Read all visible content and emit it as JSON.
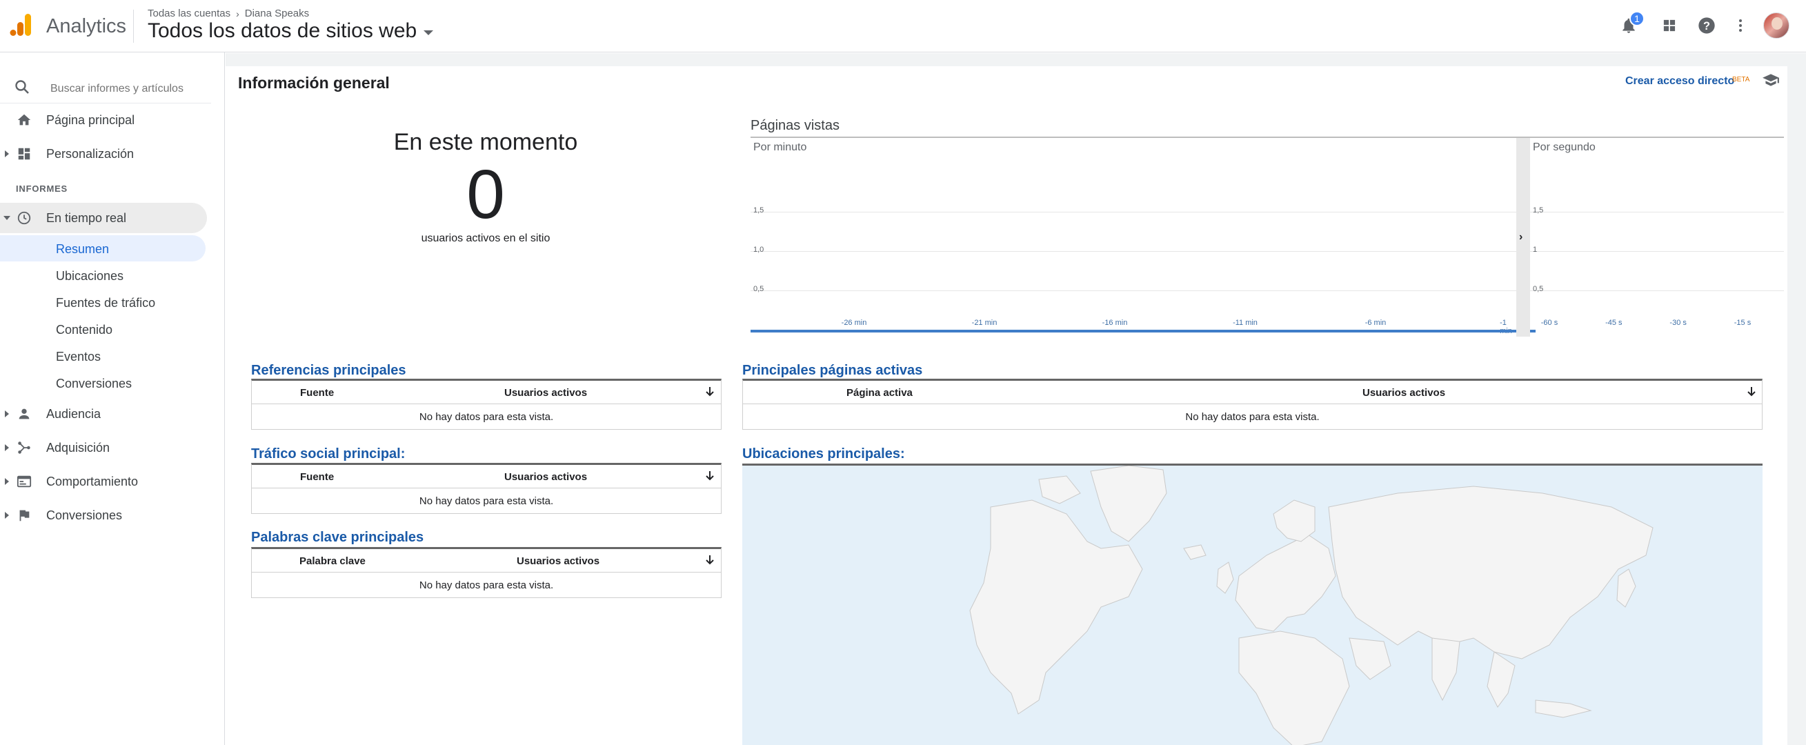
{
  "header": {
    "app_name": "Analytics",
    "breadcrumb": [
      "Todas las cuentas",
      "Diana Speaks"
    ],
    "view_title": "Todos los datos de sitios web",
    "notification_count": "1",
    "icons": [
      "bell-icon",
      "apps-grid-icon",
      "help-icon",
      "more-vert-icon",
      "avatar"
    ],
    "logo_colors": [
      "#f9ab00",
      "#e37400"
    ]
  },
  "sidebar": {
    "search_placeholder": "Buscar informes y artículos",
    "top_items": [
      {
        "label": "Página principal",
        "icon": "home-icon"
      },
      {
        "label": "Personalización",
        "icon": "dashboard-icon"
      }
    ],
    "section_label": "INFORMES",
    "realtime": {
      "label": "En tiempo real",
      "icon": "clock-icon"
    },
    "realtime_sub": [
      "Resumen",
      "Ubicaciones",
      "Fuentes de tráfico",
      "Contenido",
      "Eventos",
      "Conversiones"
    ],
    "selected_sub": "Resumen",
    "bottom_items": [
      {
        "label": "Audiencia",
        "icon": "person-icon"
      },
      {
        "label": "Adquisición",
        "icon": "acquisition-icon"
      },
      {
        "label": "Comportamiento",
        "icon": "behavior-icon"
      },
      {
        "label": "Conversiones",
        "icon": "flag-icon"
      }
    ]
  },
  "main": {
    "heading": "Información general",
    "shortcut_label": "Crear acceso directo",
    "beta_label": "BETA",
    "now": {
      "title": "En este momento",
      "value": "0",
      "subtitle": "usuarios activos en el sitio"
    },
    "pageviews": {
      "title": "Páginas vistas",
      "per_minute_label": "Por minuto",
      "per_second_label": "Por segundo"
    },
    "tables": {
      "referrals": {
        "title": "Referencias principales",
        "col1": "Fuente",
        "col2": "Usuarios activos",
        "empty": "No hay datos para esta vista."
      },
      "social": {
        "title": "Tráfico social principal:",
        "col1": "Fuente",
        "col2": "Usuarios activos",
        "empty": "No hay datos para esta vista."
      },
      "keywords": {
        "title": "Palabras clave principales",
        "col1": "Palabra clave",
        "col2": "Usuarios activos",
        "empty": "No hay datos para esta vista."
      },
      "active_pages": {
        "title": "Principales páginas activas",
        "col1": "Página activa",
        "col2": "Usuarios activos",
        "empty": "No hay datos para esta vista."
      }
    },
    "locations_title": "Ubicaciones principales:"
  },
  "chart_data": [
    {
      "type": "bar",
      "title": "Por minuto",
      "x_ticks": [
        "-26 min",
        "-21 min",
        "-16 min",
        "-11 min",
        "-6 min",
        "-1 min"
      ],
      "y_ticks": [
        "0,5",
        "1,0",
        "1,5"
      ],
      "ylim": [
        0,
        2
      ],
      "values": []
    },
    {
      "type": "bar",
      "title": "Por segundo",
      "x_ticks": [
        "-60 s",
        "-45 s",
        "-30 s",
        "-15 s"
      ],
      "y_ticks": [
        "0,5",
        "1",
        "1,5"
      ],
      "ylim": [
        0,
        2
      ],
      "values": []
    }
  ]
}
